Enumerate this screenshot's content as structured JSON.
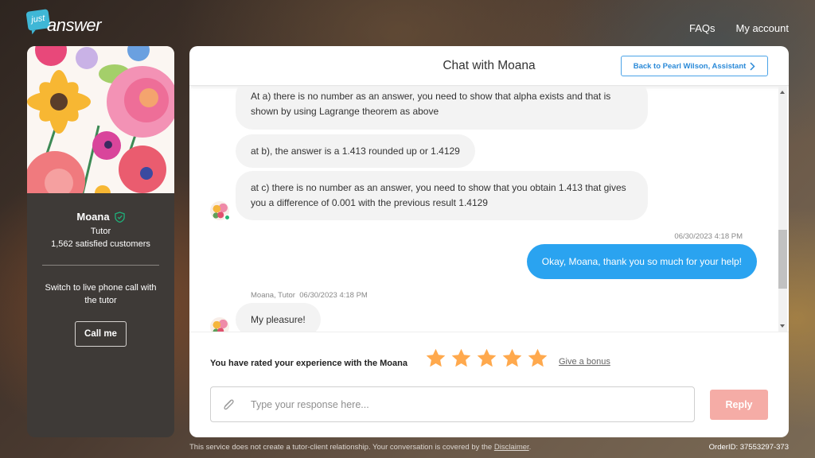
{
  "header": {
    "logo": {
      "small": "just",
      "word": "answer"
    },
    "nav": [
      {
        "label": "FAQs"
      },
      {
        "label": "My account"
      }
    ]
  },
  "expert": {
    "name": "Moana",
    "verified_icon": "shield-check-icon",
    "role": "Tutor",
    "customers": "1,562 satisfied customers",
    "switch_text": "Switch to live phone call with the tutor",
    "call_button": "Call me"
  },
  "chat": {
    "title": "Chat with Moana",
    "back_button": "Back to Pearl Wilson, Assistant",
    "messages": [
      {
        "from": "expert",
        "text": "At a) there is no number as an answer, you need to show that alpha exists and that is shown by using Lagrange theorem as above"
      },
      {
        "from": "expert",
        "text": "at b), the answer is a 1.413 rounded up or 1.4129"
      },
      {
        "from": "expert",
        "text": "at c) there is no number as an answer, you need to show that you obtain 1.413 that gives you a difference of 0.001 with the previous result 1.4129"
      },
      {
        "from": "user",
        "timestamp": "06/30/2023 4:18 PM",
        "text": "Okay, Moana, thank you so much for your help!"
      },
      {
        "from": "expert",
        "sender": "Moana, Tutor",
        "timestamp": "06/30/2023 4:18 PM",
        "text": "My pleasure!"
      }
    ],
    "scroll_position": 0.75
  },
  "footer": {
    "rating_label": "You have rated your experience with the Moana",
    "rating": 5,
    "rating_max": 5,
    "star_color": "#ffa94d",
    "bonus_link": "Give a bonus",
    "input_placeholder": "Type your response here...",
    "input_value": "",
    "reply_button": "Reply"
  },
  "bottom": {
    "disclaimer_text": "This service does not create a tutor-client relationship. Your conversation is covered by the ",
    "disclaimer_link": "Disclaimer",
    "disclaimer_end": ".",
    "order_id": "OrderID: 37553297-373"
  },
  "colors": {
    "accent_blue": "#2aa3f0",
    "reply_disabled": "#f5aca6",
    "online": "#22b573",
    "verified": "#1fb07a"
  }
}
